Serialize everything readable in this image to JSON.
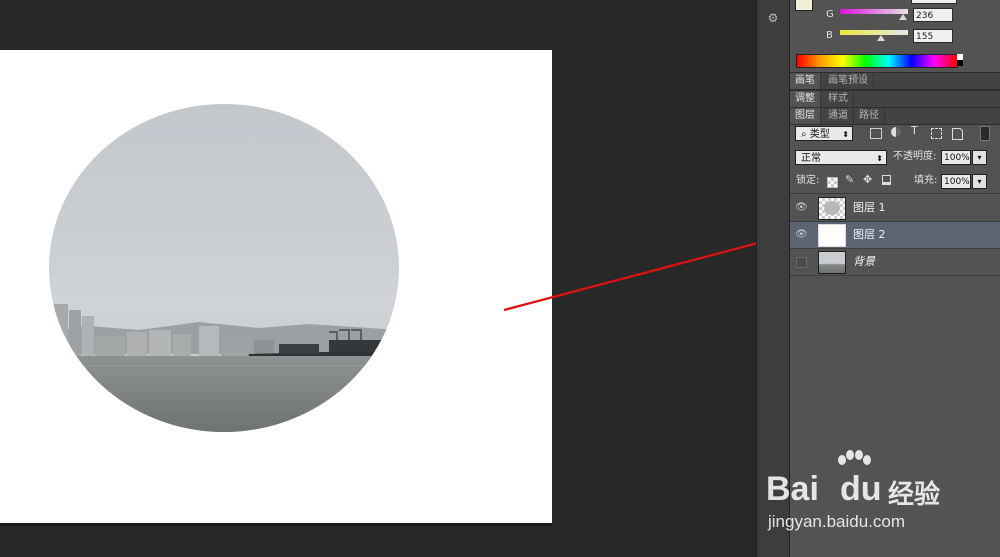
{
  "color_panel": {
    "g_label": "G",
    "g_value": "236",
    "b_label": "B",
    "b_value": "155",
    "accent_g_slider": "#c04cc0",
    "accent_b_slider": "#e7e44d"
  },
  "tab_groups": [
    {
      "tabs": [
        "画笔",
        "画笔预设"
      ],
      "active_index": 0
    },
    {
      "tabs": [
        "调整",
        "样式"
      ],
      "active_index": 0
    },
    {
      "tabs": [
        "图层",
        "通道",
        "路径"
      ],
      "active_index": 0
    }
  ],
  "layers_panel": {
    "filter_label": "类型",
    "blend_mode": "正常",
    "opacity_label": "不透明度:",
    "opacity_value": "100%",
    "lock_label": "锁定:",
    "fill_label": "填充:",
    "fill_value": "100%",
    "layers": [
      {
        "name": "图层 1",
        "visible": true,
        "selected": false
      },
      {
        "name": "图层 2",
        "visible": true,
        "selected": true
      },
      {
        "name": "背景",
        "visible": false,
        "selected": false
      }
    ]
  },
  "watermark": {
    "brand_a": "Bai",
    "brand_b": "du",
    "brand_cn": "经验",
    "url": "jingyan.baidu.com"
  },
  "colors": {
    "arrow": "#e01010",
    "selected_layer": "#5a6473"
  }
}
